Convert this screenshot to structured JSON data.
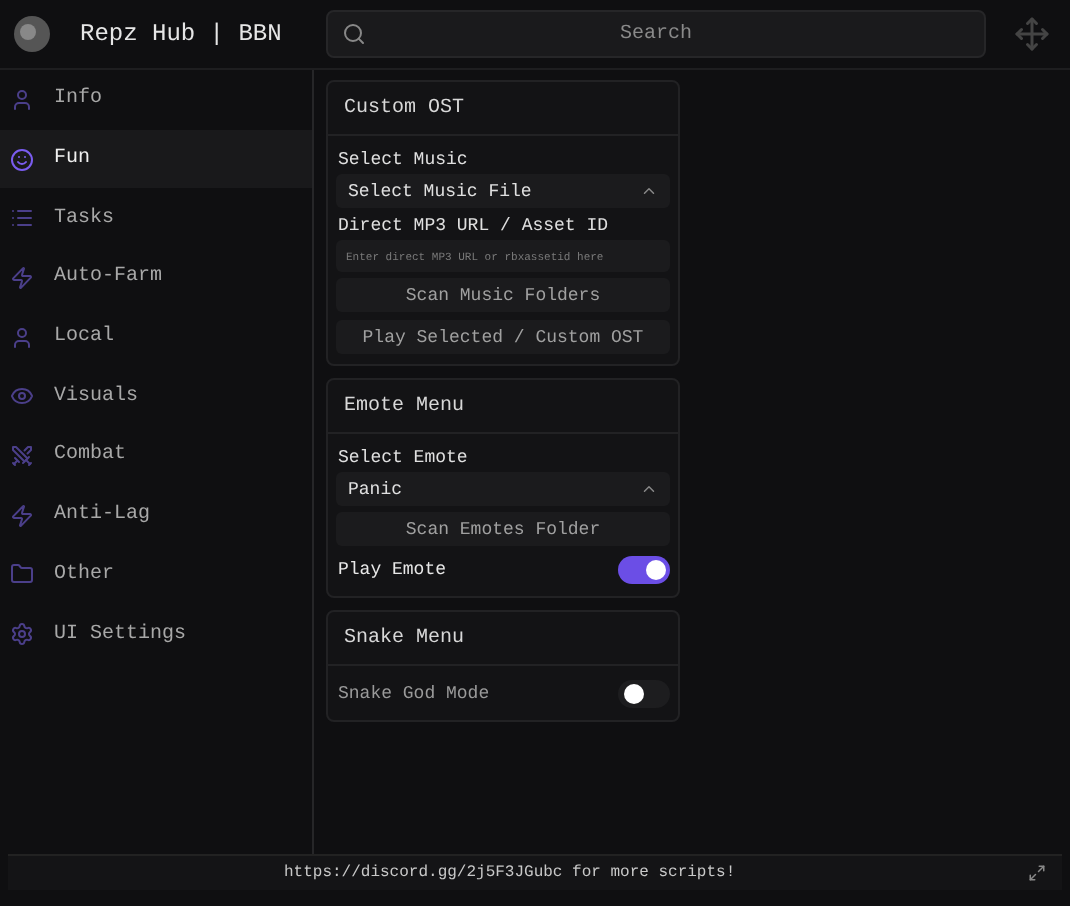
{
  "header": {
    "title": "Repz Hub | BBN",
    "search": {
      "placeholder": "Search"
    }
  },
  "sidebar": {
    "items": [
      {
        "label": "Info",
        "selected": false
      },
      {
        "label": "Fun",
        "selected": true
      },
      {
        "label": "Tasks",
        "selected": false
      },
      {
        "label": "Auto-Farm",
        "selected": false
      },
      {
        "label": "Local",
        "selected": false
      },
      {
        "label": "Visuals",
        "selected": false
      },
      {
        "label": "Combat",
        "selected": false
      },
      {
        "label": "Anti-Lag",
        "selected": false
      },
      {
        "label": "Other",
        "selected": false
      },
      {
        "label": "UI Settings",
        "selected": false
      }
    ]
  },
  "sections": [
    {
      "title": "Custom OST",
      "controls": [
        {
          "kind": "label",
          "text": "Select Music"
        },
        {
          "kind": "dropdown",
          "value": "Select Music File"
        },
        {
          "kind": "label",
          "text": "Direct MP3 URL / Asset ID"
        },
        {
          "kind": "input",
          "placeholder": "Enter direct MP3 URL or rbxassetid here"
        },
        {
          "kind": "button",
          "text": "Scan Music Folders"
        },
        {
          "kind": "button",
          "text": "Play Selected / Custom OST"
        }
      ]
    },
    {
      "title": "Emote Menu",
      "controls": [
        {
          "kind": "label",
          "text": "Select Emote"
        },
        {
          "kind": "dropdown",
          "value": "Panic"
        },
        {
          "kind": "button",
          "text": "Scan Emotes Folder"
        },
        {
          "kind": "toggle",
          "text": "Play Emote",
          "on": true
        }
      ]
    },
    {
      "title": "Snake Menu",
      "controls": [
        {
          "kind": "toggle",
          "text": "Snake God Mode",
          "on": false
        }
      ]
    }
  ],
  "footer": {
    "text": "https://discord.gg/2j5F3JGubc for more scripts!"
  }
}
